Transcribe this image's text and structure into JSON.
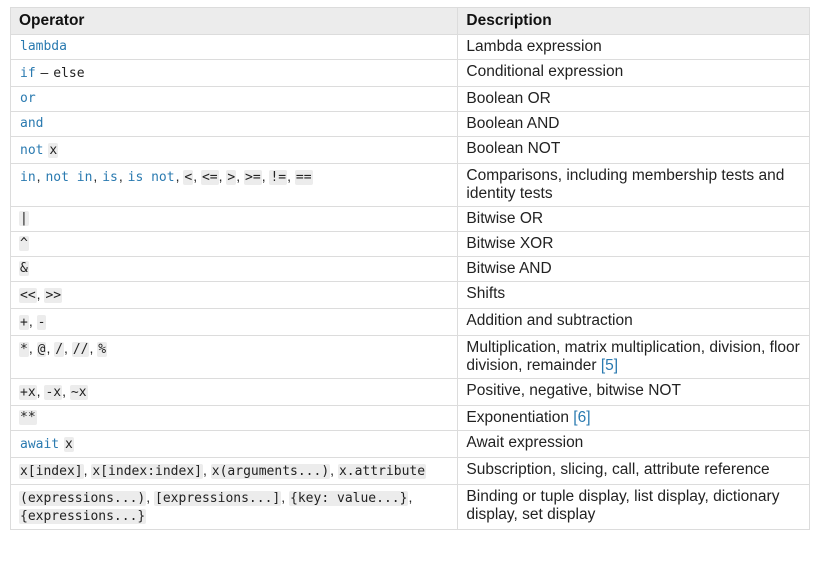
{
  "header": {
    "operator": "Operator",
    "description": "Description"
  },
  "rows": [
    {
      "op": [
        {
          "t": "lambda",
          "k": "kw"
        }
      ],
      "desc": "Lambda expression"
    },
    {
      "op": [
        {
          "t": "if",
          "k": "kw"
        },
        {
          "t": " – ",
          "k": "sep"
        },
        {
          "t": "else",
          "k": "plain"
        }
      ],
      "desc": "Conditional expression"
    },
    {
      "op": [
        {
          "t": "or",
          "k": "kw"
        }
      ],
      "desc": "Boolean OR"
    },
    {
      "op": [
        {
          "t": "and",
          "k": "kw"
        }
      ],
      "desc": "Boolean AND"
    },
    {
      "op": [
        {
          "t": "not",
          "k": "kw"
        },
        {
          "t": " ",
          "k": "sep"
        },
        {
          "t": "x",
          "k": "lit"
        }
      ],
      "desc": "Boolean NOT"
    },
    {
      "op": [
        {
          "t": "in",
          "k": "kw"
        },
        {
          "t": ", ",
          "k": "sep"
        },
        {
          "t": "not in",
          "k": "kw"
        },
        {
          "t": ", ",
          "k": "sep"
        },
        {
          "t": "is",
          "k": "kw"
        },
        {
          "t": ", ",
          "k": "sep"
        },
        {
          "t": "is not",
          "k": "kw"
        },
        {
          "t": ", ",
          "k": "sep"
        },
        {
          "t": "<",
          "k": "lit"
        },
        {
          "t": ", ",
          "k": "sep"
        },
        {
          "t": "<=",
          "k": "lit"
        },
        {
          "t": ", ",
          "k": "sep"
        },
        {
          "t": ">",
          "k": "lit"
        },
        {
          "t": ", ",
          "k": "sep"
        },
        {
          "t": ">=",
          "k": "lit"
        },
        {
          "t": ", ",
          "k": "sep"
        },
        {
          "t": "!=",
          "k": "lit"
        },
        {
          "t": ", ",
          "k": "sep"
        },
        {
          "t": "==",
          "k": "lit"
        }
      ],
      "desc": "Comparisons, including membership tests and identity tests"
    },
    {
      "op": [
        {
          "t": "|",
          "k": "lit"
        }
      ],
      "desc": "Bitwise OR"
    },
    {
      "op": [
        {
          "t": "^",
          "k": "lit"
        }
      ],
      "desc": "Bitwise XOR"
    },
    {
      "op": [
        {
          "t": "&",
          "k": "lit"
        }
      ],
      "desc": "Bitwise AND"
    },
    {
      "op": [
        {
          "t": "<<",
          "k": "lit"
        },
        {
          "t": ", ",
          "k": "sep"
        },
        {
          "t": ">>",
          "k": "lit"
        }
      ],
      "desc": "Shifts"
    },
    {
      "op": [
        {
          "t": "+",
          "k": "lit"
        },
        {
          "t": ", ",
          "k": "sep"
        },
        {
          "t": "-",
          "k": "lit"
        }
      ],
      "desc": "Addition and subtraction"
    },
    {
      "op": [
        {
          "t": "*",
          "k": "lit"
        },
        {
          "t": ", ",
          "k": "sep"
        },
        {
          "t": "@",
          "k": "lit"
        },
        {
          "t": ", ",
          "k": "sep"
        },
        {
          "t": "/",
          "k": "lit"
        },
        {
          "t": ", ",
          "k": "sep"
        },
        {
          "t": "//",
          "k": "lit"
        },
        {
          "t": ", ",
          "k": "sep"
        },
        {
          "t": "%",
          "k": "lit"
        }
      ],
      "desc": "Multiplication, matrix multiplication, division, floor division, remainder",
      "footnote": "[5]"
    },
    {
      "op": [
        {
          "t": "+x",
          "k": "lit"
        },
        {
          "t": ", ",
          "k": "sep"
        },
        {
          "t": "-x",
          "k": "lit"
        },
        {
          "t": ", ",
          "k": "sep"
        },
        {
          "t": "~x",
          "k": "lit"
        }
      ],
      "desc": "Positive, negative, bitwise NOT"
    },
    {
      "op": [
        {
          "t": "**",
          "k": "lit"
        }
      ],
      "desc": "Exponentiation",
      "footnote": "[6]"
    },
    {
      "op": [
        {
          "t": "await",
          "k": "kw"
        },
        {
          "t": " ",
          "k": "sep"
        },
        {
          "t": "x",
          "k": "lit"
        }
      ],
      "desc": "Await expression"
    },
    {
      "op": [
        {
          "t": "x[index]",
          "k": "lit"
        },
        {
          "t": ", ",
          "k": "sep"
        },
        {
          "t": "x[index:index]",
          "k": "lit"
        },
        {
          "t": ", ",
          "k": "sep"
        },
        {
          "t": "x(arguments...)",
          "k": "lit"
        },
        {
          "t": ", ",
          "k": "sep"
        },
        {
          "t": "x.attribute",
          "k": "lit"
        }
      ],
      "desc": "Subscription, slicing, call, attribute reference"
    },
    {
      "op": [
        {
          "t": "(expressions...)",
          "k": "lit"
        },
        {
          "t": ", ",
          "k": "sep"
        },
        {
          "t": "[expressions...]",
          "k": "lit"
        },
        {
          "t": ", ",
          "k": "sep"
        },
        {
          "t": "{key: value...}",
          "k": "lit"
        },
        {
          "t": ", ",
          "k": "sep"
        },
        {
          "t": "{expressions...}",
          "k": "lit"
        }
      ],
      "desc": "Binding or tuple display, list display, dictionary display, set display"
    }
  ]
}
